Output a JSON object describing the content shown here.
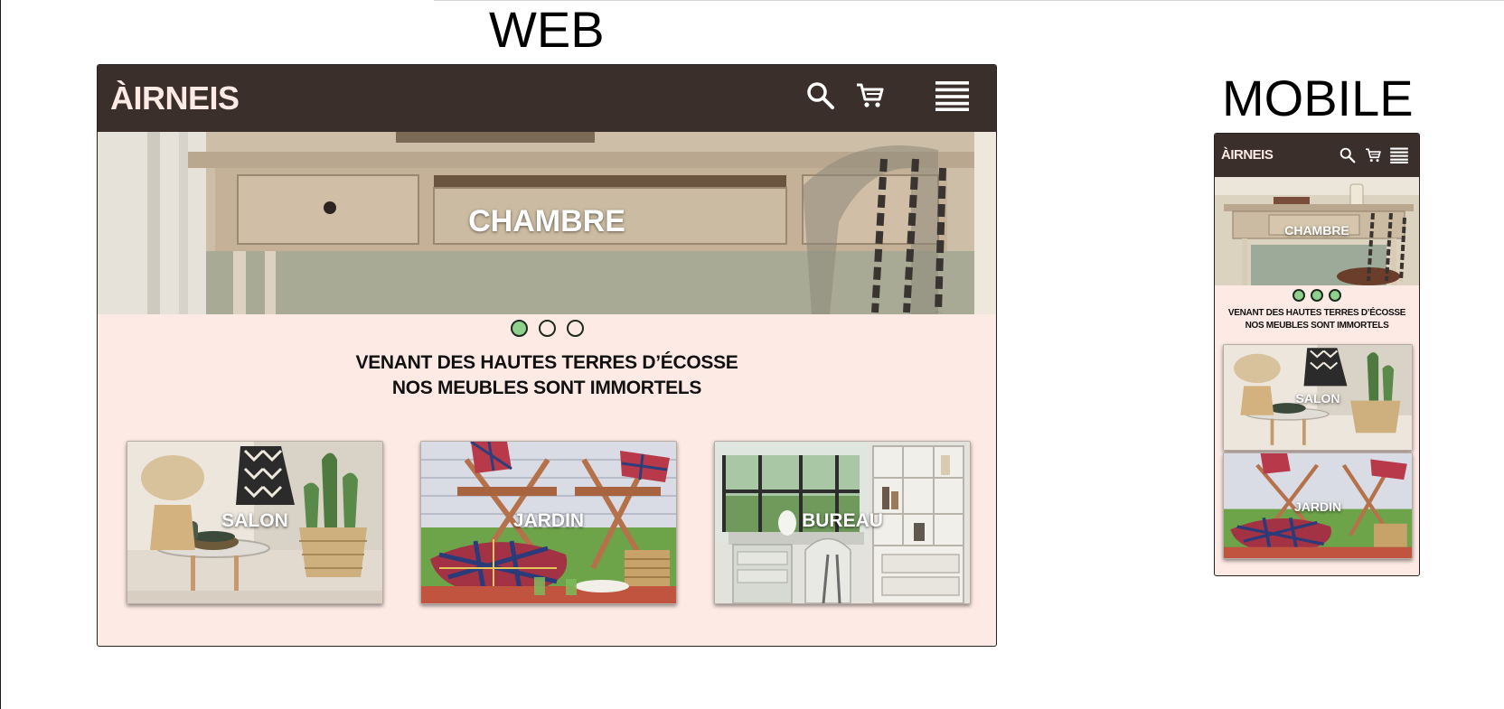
{
  "labels": {
    "web": "WEB",
    "mobile": "MOBILE"
  },
  "brand": {
    "logo": "ÀIRNEIS"
  },
  "colors": {
    "nav_background": "#3b2f2b",
    "page_background": "#fdeae4",
    "logo": "#fdeae4",
    "dot_active": "#8fd08f",
    "dot_border": "#1d2b1d"
  },
  "web": {
    "nav_icons": [
      "search-icon",
      "cart-icon",
      "menu-icon"
    ],
    "hero": {
      "title": "CHAMBRE"
    },
    "carousel": {
      "total": 3,
      "active_index": 0
    },
    "tagline": {
      "line1": "VENANT DES HAUTES TERRES D’ÉCOSSE",
      "line2": "NOS MEUBLES SONT IMMORTELS"
    },
    "categories": [
      {
        "label": "SALON",
        "scene": "living-room-photo"
      },
      {
        "label": "JARDIN",
        "scene": "garden-photo"
      },
      {
        "label": "BUREAU",
        "scene": "office-photo"
      }
    ]
  },
  "mobile": {
    "nav_icons": [
      "search-icon",
      "cart-icon",
      "menu-icon"
    ],
    "hero": {
      "title": "CHAMBRE"
    },
    "carousel": {
      "total": 3
    },
    "tagline": {
      "line1": "VENANT DES HAUTES TERRES D’ÉCOSSE",
      "line2": "NOS MEUBLES SONT IMMORTELS"
    },
    "categories": [
      {
        "label": "SALON",
        "scene": "living-room-photo"
      },
      {
        "label": "JARDIN",
        "scene": "garden-photo"
      }
    ]
  }
}
